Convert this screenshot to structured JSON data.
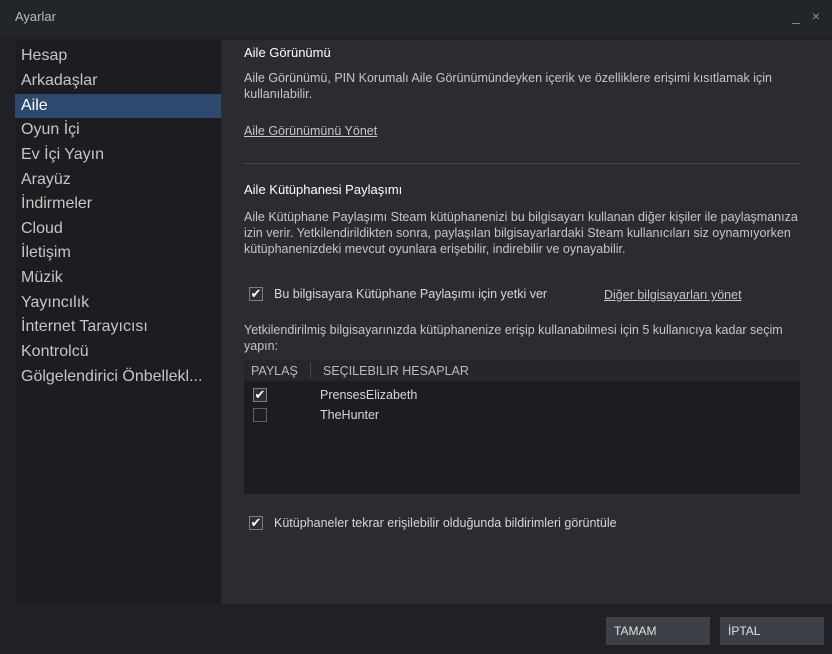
{
  "window": {
    "title": "Ayarlar",
    "minimize_glyph": "_",
    "close_glyph": "×"
  },
  "sidebar": {
    "items": [
      {
        "label": "Hesap"
      },
      {
        "label": "Arkadaşlar"
      },
      {
        "label": "Aile",
        "active": true
      },
      {
        "label": "Oyun İçi"
      },
      {
        "label": "Ev İçi Yayın"
      },
      {
        "label": "Arayüz"
      },
      {
        "label": "İndirmeler"
      },
      {
        "label": "Cloud"
      },
      {
        "label": "İletişim"
      },
      {
        "label": "Müzik"
      },
      {
        "label": "Yayıncılık"
      },
      {
        "label": "İnternet Tarayıcısı"
      },
      {
        "label": "Kontrolcü"
      },
      {
        "label": "Gölgelendirici Önbellekl..."
      }
    ]
  },
  "family_view": {
    "title": "Aile Görünümü",
    "description": "Aile Görünümü, PIN Korumalı Aile Görünümündeyken içerik ve özelliklere erişimi kısıtlamak için kullanılabilir.",
    "manage_link": "Aile Görünümünü Yönet"
  },
  "library_sharing": {
    "title": "Aile Kütüphanesi Paylaşımı",
    "description": "Aile Kütüphane Paylaşımı Steam kütüphanenizi bu bilgisayarı kullanan diğer kişiler ile paylaşmanıza izin verir. Yetkilendirildikten sonra, paylaşılan bilgisayarlardaki Steam kullanıcıları siz oynamıyorken kütüphanenizdeki mevcut oyunlara erişebilir, indirebilir ve oynayabilir.",
    "authorize_checkbox": {
      "label": "Bu bilgisayara Kütüphane Paylaşımı için yetki ver",
      "checked": true
    },
    "manage_other_link": "Diğer bilgisayarları yönet",
    "accounts_hint": "Yetkilendirilmiş bilgisayarınızda kütüphanenize erişip kullanabilmesi için 5 kullanıcıya kadar seçim yapın:",
    "table": {
      "columns": [
        "PAYLAŞ",
        "SEÇILEBILIR HESAPLAR"
      ],
      "rows": [
        {
          "share": true,
          "account": "PrensesElizabeth"
        },
        {
          "share": false,
          "account": "TheHunter"
        }
      ]
    },
    "notify_checkbox": {
      "label": "Kütüphaneler tekrar erişilebilir olduğunda bildirimleri görüntüle",
      "checked": true
    }
  },
  "footer": {
    "ok_label": "TAMAM",
    "cancel_label": "İPTAL"
  },
  "icons": {
    "check_glyph": "✔"
  },
  "colors": {
    "active_item": "#2d4a6e",
    "background": "#1f2126",
    "panel": "#2a2c31"
  }
}
